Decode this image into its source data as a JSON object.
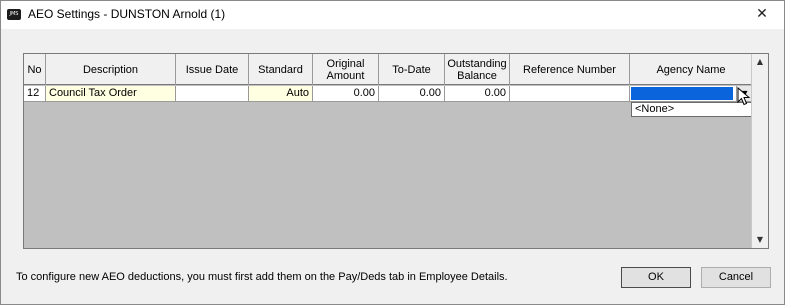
{
  "window": {
    "title": "AEO Settings - DUNSTON Arnold (1)",
    "app_icon_text": "JMS",
    "close_glyph": "✕"
  },
  "grid": {
    "columns": [
      "No",
      "Description",
      "Issue Date",
      "Standard",
      "Original Amount",
      "To-Date",
      "Outstanding Balance",
      "Reference Number",
      "Agency Name"
    ],
    "rows": [
      {
        "no": "12",
        "description": "Council Tax Order",
        "issue_date": "",
        "standard": "Auto",
        "original_amount": "0.00",
        "to_date": "0.00",
        "outstanding_balance": "0.00",
        "reference_number": "",
        "agency_name": ""
      }
    ],
    "agency_dropdown": {
      "options": [
        "<None>"
      ],
      "selected_color": "#0a64dc",
      "open": true
    }
  },
  "footer": {
    "note": "To configure new AEO deductions, you must first add them on the Pay/Deds tab in Employee Details.",
    "ok_label": "OK",
    "cancel_label": "Cancel"
  },
  "icons": {
    "close": "close-icon",
    "dropdown": "chevron-down-icon",
    "scroll_up": "arrow-up-icon",
    "scroll_down": "arrow-down-icon",
    "cursor": "mouse-pointer-icon"
  }
}
